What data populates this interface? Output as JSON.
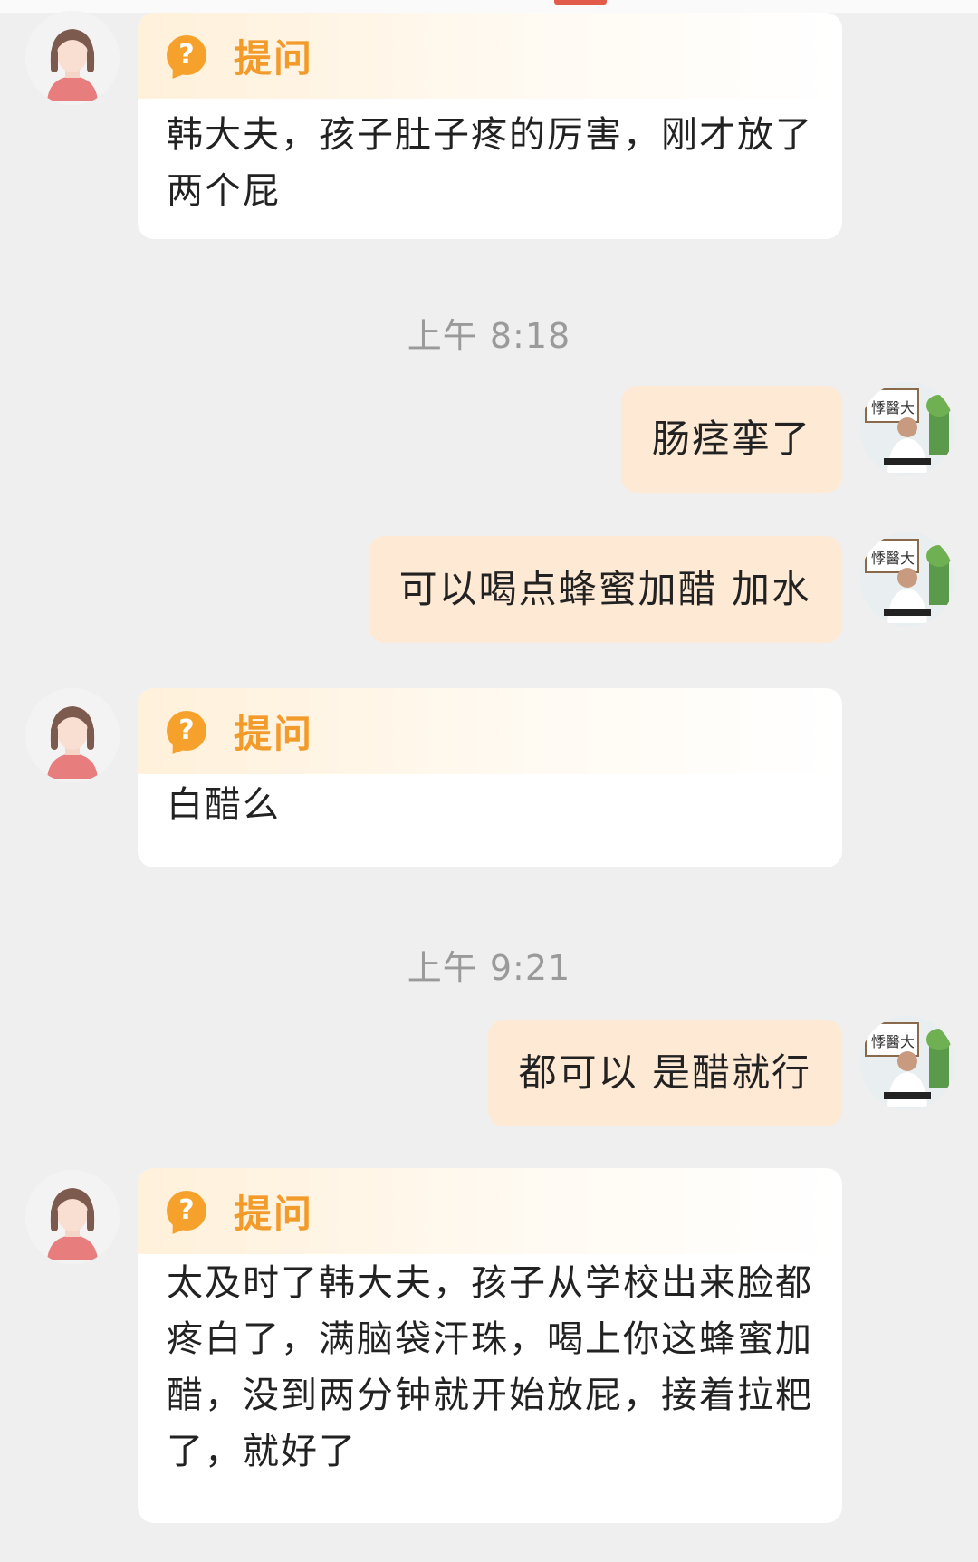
{
  "messages": [
    {
      "type": "question",
      "label": "提问",
      "text": "韩大夫，孩子肚子疼的厉害，刚才放了两个屁"
    },
    {
      "type": "time",
      "text": "上午 8:18"
    },
    {
      "type": "answer",
      "text": "肠痉挛了"
    },
    {
      "type": "answer",
      "text": "可以喝点蜂蜜加醋 加水"
    },
    {
      "type": "question",
      "label": "提问",
      "text": "白醋么"
    },
    {
      "type": "time",
      "text": "上午 9:21"
    },
    {
      "type": "answer",
      "text": "都可以 是醋就行"
    },
    {
      "type": "question",
      "label": "提问",
      "text": "太及时了韩大夫，孩子从学校出来脸都疼白了，满脑袋汗珠，喝上你这蜂蜜加醋，没到两分钟就开始放屁，接着拉粑了，就好了"
    }
  ],
  "icons": {
    "question": "question-mark-icon",
    "user_avatar": "girl-avatar-icon",
    "doctor_avatar": "doctor-avatar-icon"
  },
  "colors": {
    "background": "#efefef",
    "question_bubble": "#ffffff",
    "answer_bubble": "#fde9d4",
    "question_label": "#f29a2a",
    "time_text": "#9a9a9a"
  }
}
